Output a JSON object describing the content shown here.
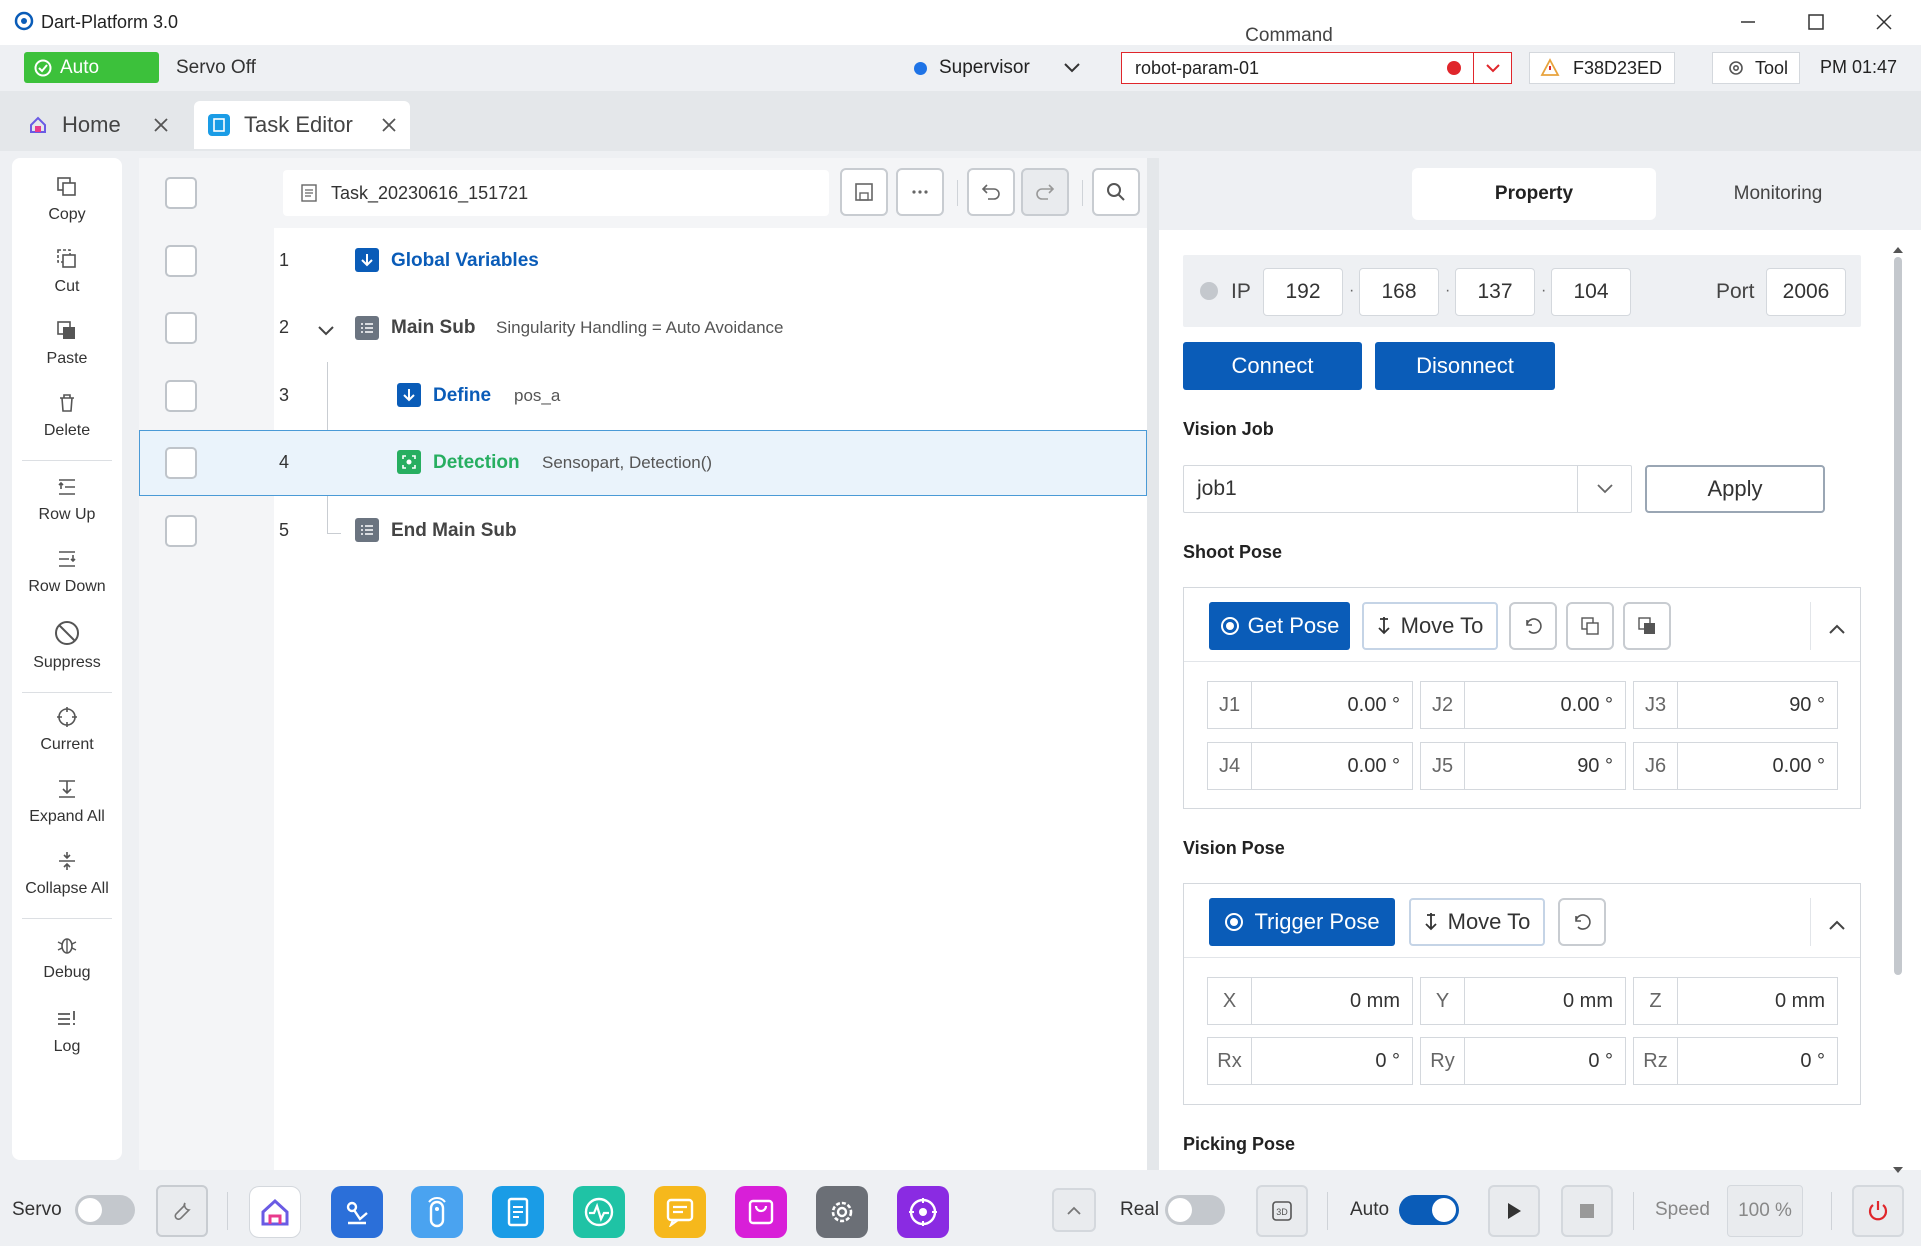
{
  "window": {
    "title": "Dart-Platform 3.0"
  },
  "status": {
    "mode": "Auto",
    "servo": "Servo Off",
    "role": "Supervisor",
    "param": "robot-param-01",
    "device_id": "F38D23ED",
    "tool_label": "Tool",
    "time": "PM 01:47"
  },
  "tabs": [
    {
      "label": "Home"
    },
    {
      "label": "Task Editor"
    }
  ],
  "sidebar": {
    "items": [
      {
        "label": "Copy"
      },
      {
        "label": "Cut"
      },
      {
        "label": "Paste"
      },
      {
        "label": "Delete"
      },
      {
        "label": "Row Up"
      },
      {
        "label": "Row Down"
      },
      {
        "label": "Suppress"
      },
      {
        "label": "Current"
      },
      {
        "label": "Expand All"
      },
      {
        "label": "Collapse All"
      },
      {
        "label": "Debug"
      },
      {
        "label": "Log"
      }
    ]
  },
  "editor": {
    "task_name": "Task_20230616_151721",
    "rows": [
      {
        "num": "1",
        "name": "Global Variables",
        "detail": ""
      },
      {
        "num": "2",
        "name": "Main Sub",
        "detail": "Singularity Handling = Auto Avoidance"
      },
      {
        "num": "3",
        "name": "Define",
        "detail": "pos_a"
      },
      {
        "num": "4",
        "name": "Detection",
        "detail": "Sensopart, Detection()"
      },
      {
        "num": "5",
        "name": "End Main Sub",
        "detail": ""
      }
    ]
  },
  "panel": {
    "tabs": [
      {
        "label": "Command"
      },
      {
        "label": "Property"
      },
      {
        "label": "Monitoring"
      }
    ],
    "ip_label": "IP",
    "ip": [
      "192",
      "168",
      "137",
      "104"
    ],
    "port_label": "Port",
    "port": "2006",
    "connect": "Connect",
    "disconnect": "Disonnect",
    "vision_job_label": "Vision Job",
    "vision_job": "job1",
    "apply": "Apply",
    "shoot_pose_label": "Shoot Pose",
    "get_pose": "Get Pose",
    "move_to": "Move To",
    "joints": [
      {
        "label": "J1",
        "value": "0.00 °"
      },
      {
        "label": "J2",
        "value": "0.00 °"
      },
      {
        "label": "J3",
        "value": "90 °"
      },
      {
        "label": "J4",
        "value": "0.00 °"
      },
      {
        "label": "J5",
        "value": "90 °"
      },
      {
        "label": "J6",
        "value": "0.00 °"
      }
    ],
    "vision_pose_label": "Vision Pose",
    "trigger_pose": "Trigger Pose",
    "coords": [
      {
        "label": "X",
        "value": "0 mm"
      },
      {
        "label": "Y",
        "value": "0 mm"
      },
      {
        "label": "Z",
        "value": "0 mm"
      },
      {
        "label": "Rx",
        "value": "0 °"
      },
      {
        "label": "Ry",
        "value": "0 °"
      },
      {
        "label": "Rz",
        "value": "0 °"
      }
    ],
    "picking_pose_label": "Picking Pose"
  },
  "bottom": {
    "servo": "Servo",
    "real": "Real",
    "auto": "Auto",
    "speed_label": "Speed",
    "speed": "100 %"
  },
  "colors": {
    "accent": "#0a5cb8",
    "auto_green": "#3cc13b",
    "detection_green": "#27ae60",
    "record_red": "#e0262b"
  }
}
